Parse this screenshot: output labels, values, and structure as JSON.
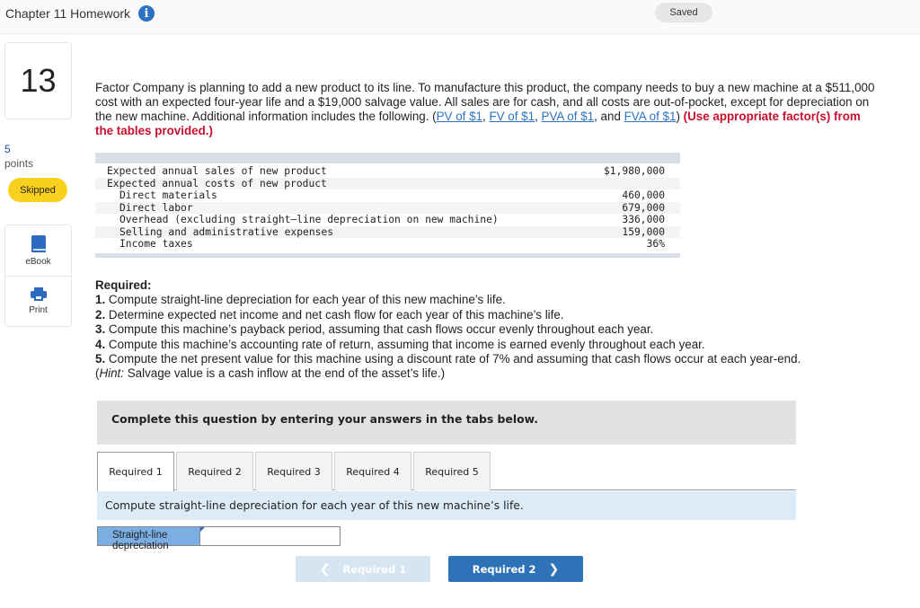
{
  "header": {
    "title": "Chapter 11 Homework",
    "info_icon": "i",
    "saved_status": "Saved"
  },
  "sidebar": {
    "question_number": "13",
    "points_value": "5",
    "points_label": "points",
    "status_badge": "Skipped",
    "tools": [
      {
        "label": "eBook",
        "icon": "book-icon"
      },
      {
        "label": "Print",
        "icon": "printer-icon"
      }
    ]
  },
  "question": {
    "intro_text": "Factor Company is planning to add a new product to its line. To manufacture this product, the company needs to buy a new machine at a $511,000 cost with an expected four-year life and a $19,000 salvage value. All sales are for cash, and all costs are out-of-pocket, except for depreciation on the new machine. Additional information includes the following. (",
    "links": [
      "PV of $1",
      "FV of $1",
      "PVA of $1",
      "FVA of $1"
    ],
    "sep1": ", ",
    "sep2": ", ",
    "sep3": ", and ",
    "close_paren": ") ",
    "instruction_red": "(Use appropriate factor(s) from the tables provided.)"
  },
  "data_table": {
    "rows": [
      {
        "label": "Expected annual sales of new product",
        "value": "$1,980,000",
        "indent": false
      },
      {
        "label": "Expected annual costs of new product",
        "value": "",
        "indent": false
      },
      {
        "label": "Direct materials",
        "value": "460,000",
        "indent": true
      },
      {
        "label": "Direct labor",
        "value": "679,000",
        "indent": true
      },
      {
        "label": "Overhead (excluding straight–line depreciation on new machine)",
        "value": "336,000",
        "indent": true
      },
      {
        "label": "Selling and administrative expenses",
        "value": "159,000",
        "indent": true
      },
      {
        "label": "Income taxes",
        "value": "36%",
        "indent": true
      }
    ]
  },
  "required": {
    "heading": "Required:",
    "items": [
      {
        "num": "1.",
        "text": " Compute straight-line depreciation for each year of this new machine’s life."
      },
      {
        "num": "2.",
        "text": " Determine expected net income and net cash flow for each year of this machine’s life."
      },
      {
        "num": "3.",
        "text": " Compute this machine’s payback period, assuming that cash flows occur evenly throughout each year."
      },
      {
        "num": "4.",
        "text": " Compute this machine’s accounting rate of return, assuming that income is earned evenly throughout each year."
      },
      {
        "num": "5.",
        "text": " Compute the net present value for this machine using a discount rate of 7% and assuming that cash flows occur at each year-end."
      }
    ],
    "hint_open": "(",
    "hint_label": "Hint:",
    "hint_text": " Salvage value is a cash inflow at the end of the asset’s life.)"
  },
  "answer_area": {
    "banner": "Complete this question by entering your answers in the tabs below.",
    "tabs": [
      "Required 1",
      "Required 2",
      "Required 3",
      "Required 4",
      "Required 5"
    ],
    "active_tab": "Required 1",
    "instruction": "Compute straight-line depreciation for each year of this new machine’s life.",
    "field_label": "Straight-line depreciation",
    "field_value": "",
    "prev_button": "Required 1",
    "next_button": "Required 2"
  },
  "colors": {
    "accent_blue": "#2e72b8",
    "link_blue": "#2d72c2",
    "warning_red": "#c8102e",
    "skipped_yellow": "#f8d11f",
    "label_cell_blue": "#7bafe4",
    "instruction_bg": "#dcebf8"
  }
}
